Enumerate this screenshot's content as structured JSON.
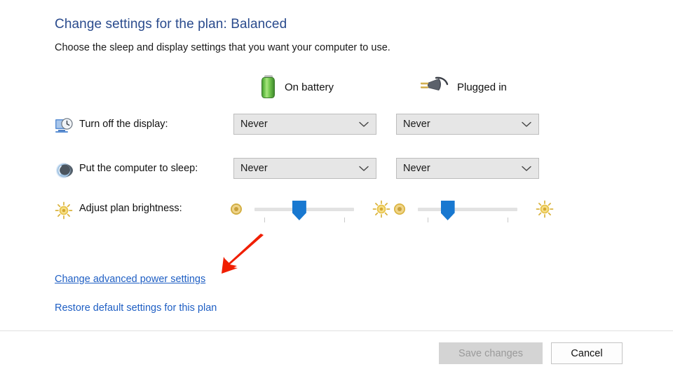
{
  "header": {
    "title": "Change settings for the plan: Balanced",
    "subtitle": "Choose the sleep and display settings that you want your computer to use."
  },
  "columns": [
    {
      "id": "battery",
      "label": "On battery",
      "icon": "battery-icon"
    },
    {
      "id": "plugged",
      "label": "Plugged in",
      "icon": "power-plug-icon"
    }
  ],
  "rows": [
    {
      "id": "turn-off-display",
      "label": "Turn off the display:",
      "icon": "display-clock-icon",
      "control": "dropdown",
      "battery_value": "Never",
      "plugged_value": "Never"
    },
    {
      "id": "put-computer-to-sleep",
      "label": "Put the computer to sleep:",
      "icon": "sleep-moon-icon",
      "control": "dropdown",
      "battery_value": "Never",
      "plugged_value": "Never"
    },
    {
      "id": "adjust-plan-brightness",
      "label": "Adjust plan brightness:",
      "icon": "sun-icon",
      "control": "slider",
      "battery_percent": 45,
      "plugged_percent": 30,
      "dim_icon": "dim-brightness-icon",
      "bright_icon": "bright-brightness-icon"
    }
  ],
  "links": {
    "advanced": "Change advanced power settings",
    "restore": "Restore default settings for this plan"
  },
  "annotation": {
    "arrow_icon": "red-arrow-icon",
    "color": "#f01e00"
  },
  "footer": {
    "save_label": "Save changes",
    "cancel_label": "Cancel",
    "save_enabled": false
  },
  "colors": {
    "title": "#2a4b8d",
    "link": "#1f5fc4",
    "slider_thumb": "#1878d0",
    "battery_green": "#6dc54b",
    "annotation_red": "#f01e00"
  }
}
